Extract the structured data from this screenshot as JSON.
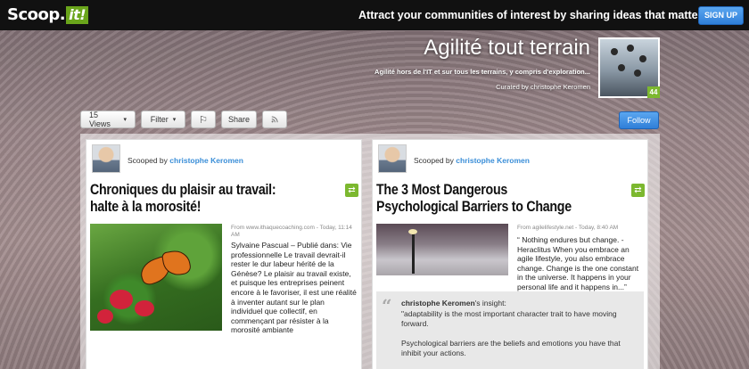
{
  "topbar": {
    "logo_text": "Scoop.",
    "logo_it": "it!",
    "tagline": "Attract your communities of interest by sharing ideas that matter",
    "signup_label": "SIGN UP"
  },
  "topic": {
    "title": "Agilité tout terrain",
    "description": "Agilité hors de l'IT et sur tous les terrains, y compris d'exploration...",
    "curated_by": "Curated by christophe Keromen",
    "thumb_badge": "44"
  },
  "toolbar": {
    "views_label": "15 Views",
    "filter_label": "Filter",
    "share_label": "Share",
    "follow_label": "Follow"
  },
  "posts": [
    {
      "scooped_prefix": "Scooped by",
      "scooped_name": "christophe Keromen",
      "title": "Chroniques du plaisir au travail: halte à la morosité!",
      "source": "From www.ithaquecoaching.com - Today, 11:14 AM",
      "excerpt": "Sylvaine Pascual – Publié dans: Vie professionnelle    Le travail devrait-il rester le dur labeur hérité de la Génèse? Le plaisir au travail existe, et puisque les entreprises peinent encore à le favoriser,  il est une réalité à inventer autant sur le plan individuel que collectif, en commençant par résister à la morosité ambiante"
    },
    {
      "scooped_prefix": "Scooped by",
      "scooped_name": "christophe Keromen",
      "title": "The 3 Most Dangerous Psychological Barriers to Change",
      "source": "From agilelifestyle.net - Today, 8:40 AM",
      "excerpt": "“ Nothing endures but change. - Heraclitus When you embrace an agile lifestyle, you also embrace change. Change is the one constant in the universe. It happens in your personal life and it happens in...”",
      "insight_name": "christophe Keromen",
      "insight_suffix": "'s insight:",
      "insight_p1": "\"adaptability is the most important character trait to have moving forward.",
      "insight_p2": "Psychological barriers are the beliefs and emotions you have that inhibit your actions."
    }
  ],
  "icons": {
    "caret": "▾",
    "rescoop": "⇄",
    "flag": "⚐",
    "rss": "rss-icon"
  }
}
